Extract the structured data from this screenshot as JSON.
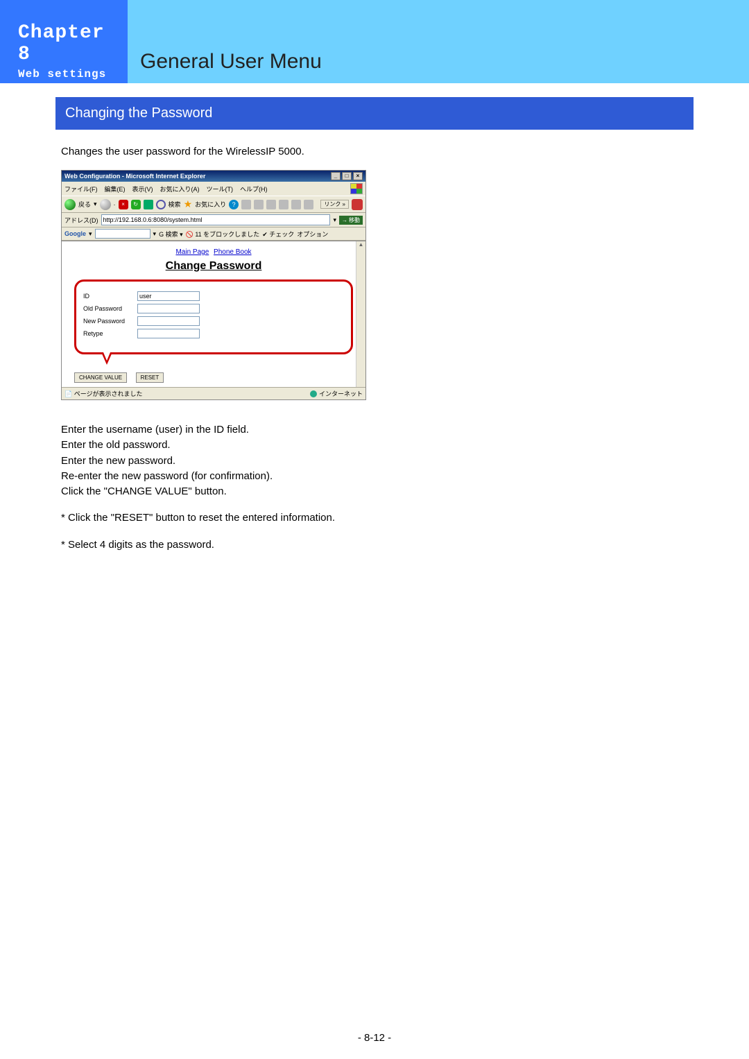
{
  "sidebar": {
    "chapter": "Chapter 8",
    "subtitle": "Web settings"
  },
  "header": {
    "title": "General User Menu"
  },
  "section": {
    "title": "Changing the Password"
  },
  "intro": "Changes the user password for the WirelessIP 5000.",
  "ie": {
    "title": "Web Configuration - Microsoft Internet Explorer",
    "menus": [
      "ファイル(F)",
      "編集(E)",
      "表示(V)",
      "お気に入り(A)",
      "ツール(T)",
      "ヘルプ(H)"
    ],
    "toolbar": {
      "back": "戻る",
      "search": "検索",
      "fav": "お気に入り",
      "link": "リンク"
    },
    "addr_label": "アドレス(D)",
    "addr_value": "http://192.168.0.6:8080/system.html",
    "go": "移動",
    "google": {
      "label": "Google",
      "btn_search": "検索",
      "blocked": "11 をブロックしました",
      "check": "チェック",
      "options": "オプション"
    },
    "links": {
      "main": "Main Page",
      "phone": "Phone Book"
    },
    "heading": "Change Password",
    "form": {
      "id_label": "ID",
      "id_value": "user",
      "old_label": "Old Password",
      "new_label": "New Password",
      "retype_label": "Retype"
    },
    "buttons": {
      "change": "CHANGE VALUE",
      "reset": "RESET"
    },
    "status_left": "ページが表示されました",
    "status_right": "インターネット"
  },
  "instructions": {
    "l1": "Enter the username (user) in the ID field.",
    "l2": "Enter the old password.",
    "l3": "Enter the new password.",
    "l4": "Re-enter the new password (for confirmation).",
    "l5": "Click the \"CHANGE VALUE\" button.",
    "n1": "* Click the \"RESET\" button to reset the entered information.",
    "n2": "* Select 4 digits as the password."
  },
  "page_number": "- 8-12 -"
}
